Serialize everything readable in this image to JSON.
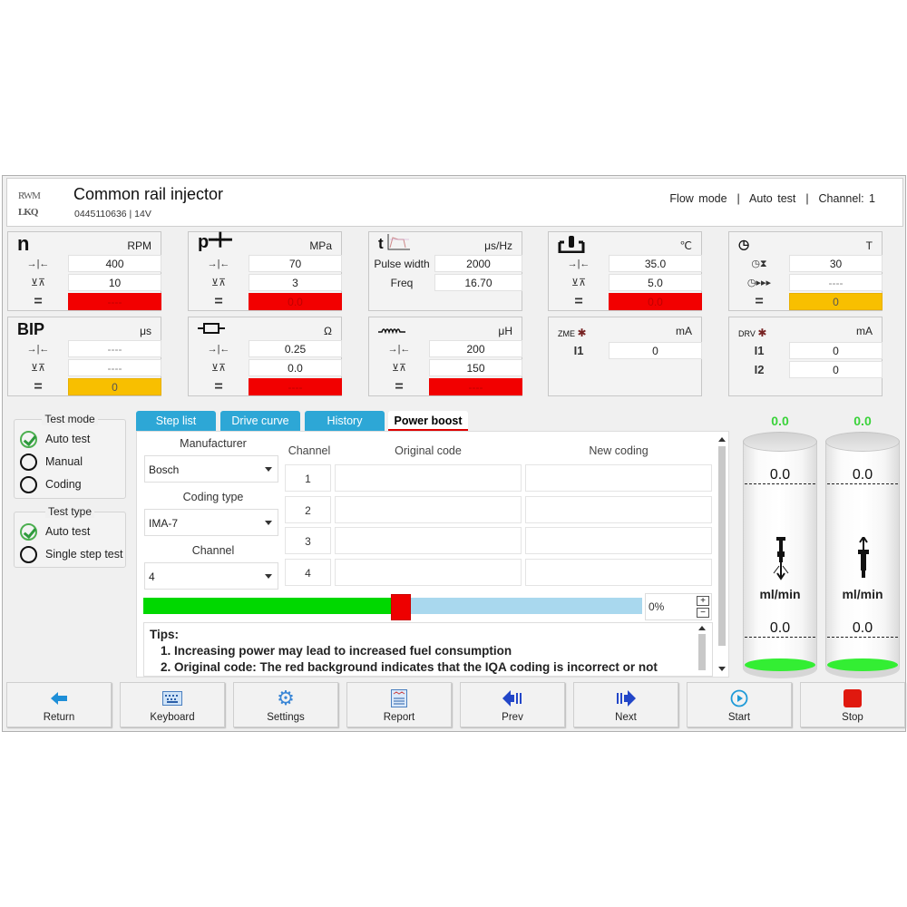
{
  "header": {
    "logo_text": [
      "RWM",
      "LKQ"
    ],
    "title": "Common rail injector",
    "subtitle": "0445110636 | 14V",
    "status": {
      "mode": "Flow mode",
      "test": "Auto test",
      "channel": "Channel: 1"
    },
    "separator": "|"
  },
  "panels": {
    "rpm": {
      "title": "n",
      "unit": "RPM",
      "sym_target": "→|←",
      "sym_tol": "⊻⊼",
      "sym_eq": "=",
      "target": "400",
      "tolerance": "10",
      "actual": "----",
      "actual_state": "red"
    },
    "pressure": {
      "title": "p",
      "unit": "MPa",
      "target": "70",
      "tolerance": "3",
      "actual": "0.0",
      "actual_state": "red"
    },
    "pulse": {
      "title": "t",
      "unit": "μs/Hz",
      "pulse_label": "Pulse width",
      "pulse_value": "2000",
      "freq_label": "Freq",
      "freq_value": "16.70"
    },
    "temperature": {
      "unit": "℃",
      "target": "35.0",
      "tolerance": "5.0",
      "actual": "0.0",
      "actual_state": "red"
    },
    "time": {
      "unit": "T",
      "wait": "30",
      "run": "----",
      "actual": "0",
      "actual_state": "amber"
    },
    "bip": {
      "title": "BIP",
      "unit": "μs",
      "target": "----",
      "tolerance": "----",
      "actual": "0",
      "actual_state": "amber"
    },
    "resistance": {
      "unit": "Ω",
      "target": "0.25",
      "tolerance": "0.0",
      "actual": "----",
      "actual_state": "red"
    },
    "inductance": {
      "unit": "μH",
      "target": "200",
      "tolerance": "150",
      "actual": "----",
      "actual_state": "red"
    },
    "zme": {
      "title": "ZME",
      "unit": "mA",
      "i1_label": "I1",
      "i1": "0"
    },
    "drv": {
      "title": "DRV",
      "unit": "mA",
      "i1_label": "I1",
      "i1": "0",
      "i2_label": "I2",
      "i2": "0"
    }
  },
  "sidebar": {
    "test_mode": {
      "title": "Test mode",
      "options": [
        {
          "label": "Auto test",
          "checked": true
        },
        {
          "label": "Manual",
          "checked": false
        },
        {
          "label": "Coding",
          "checked": false
        }
      ]
    },
    "test_type": {
      "title": "Test type",
      "options": [
        {
          "label": "Auto test",
          "checked": true
        },
        {
          "label": "Single step test",
          "checked": false
        }
      ]
    }
  },
  "tabs": [
    {
      "label": "Step list",
      "active": false
    },
    {
      "label": "Drive curve",
      "active": false
    },
    {
      "label": "History",
      "active": false
    },
    {
      "label": "Power boost",
      "active": true
    }
  ],
  "power_boost": {
    "manufacturer_label": "Manufacturer",
    "manufacturer": "Bosch",
    "coding_type_label": "Coding type",
    "coding_type": "IMA-7",
    "channel_label": "Channel",
    "channel": "4",
    "table": {
      "headers": [
        "Channel",
        "Original code",
        "New coding"
      ],
      "rows": [
        {
          "channel": "1",
          "original": "",
          "new": ""
        },
        {
          "channel": "2",
          "original": "",
          "new": ""
        },
        {
          "channel": "3",
          "original": "",
          "new": ""
        },
        {
          "channel": "4",
          "original": "",
          "new": ""
        }
      ]
    },
    "slider_fill_fraction": 0.5,
    "percent": "0%",
    "plus": "+",
    "minus": "−",
    "tips": {
      "title": "Tips:",
      "lines": [
        "1. Increasing power may lead to increased fuel consumption",
        "2. Original code: The red background indicates that the IQA coding is incorrect or not"
      ]
    }
  },
  "cylinders": [
    {
      "readout": "0.0",
      "top_mark": "0.0",
      "bottom_mark": "0.0",
      "unit": "ml/min",
      "direction": "injection"
    },
    {
      "readout": "0.0",
      "top_mark": "0.0",
      "bottom_mark": "0.0",
      "unit": "ml/min",
      "direction": "return"
    }
  ],
  "colors": {
    "alarm": "#f20000",
    "warning": "#f8bf00",
    "tab": "#2da7d6",
    "readout": "#3ad23a",
    "slider_fill": "#00d800",
    "slider_track": "#a9d8ee"
  },
  "toolbar": [
    {
      "label": "Return",
      "icon": "arrow-left-icon"
    },
    {
      "label": "Keyboard",
      "icon": "keyboard-icon"
    },
    {
      "label": "Settings",
      "icon": "gear-icon"
    },
    {
      "label": "Report",
      "icon": "report-icon"
    },
    {
      "label": "Prev",
      "icon": "prev-icon"
    },
    {
      "label": "Next",
      "icon": "next-icon"
    },
    {
      "label": "Start",
      "icon": "play-icon"
    },
    {
      "label": "Stop",
      "icon": "stop-icon"
    }
  ]
}
